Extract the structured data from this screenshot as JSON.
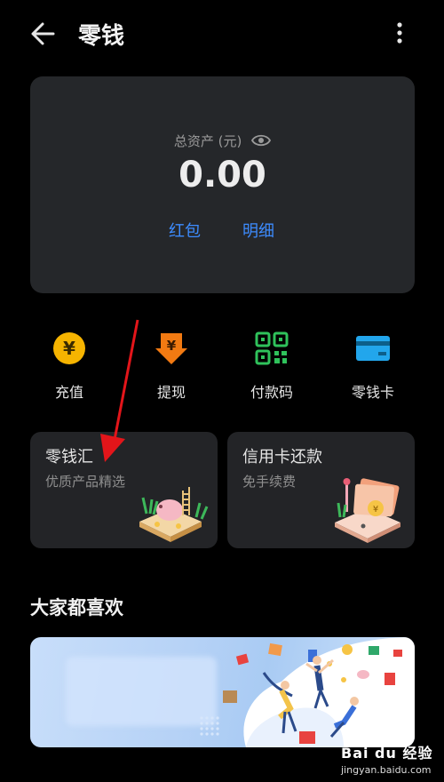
{
  "header": {
    "title": "零钱"
  },
  "assets": {
    "label": "总资产 (元)",
    "value": "0.00",
    "links": {
      "red_packet": "红包",
      "detail": "明细"
    }
  },
  "quick_actions": [
    {
      "label": "充值",
      "icon": "yuan-coin-icon",
      "color": "#f6b400"
    },
    {
      "label": "提现",
      "icon": "withdraw-icon",
      "color": "#f27a12"
    },
    {
      "label": "付款码",
      "icon": "qr-code-icon",
      "color": "#2fc25b"
    },
    {
      "label": "零钱卡",
      "icon": "card-icon",
      "color": "#22a6ec"
    }
  ],
  "promos": [
    {
      "title": "零钱汇",
      "subtitle": "优质产品精选"
    },
    {
      "title": "信用卡还款",
      "subtitle": "免手续费"
    }
  ],
  "section": {
    "title": "大家都喜欢"
  },
  "watermark": {
    "logo": "Bai du 经验",
    "url": "jingyan.baidu.com"
  },
  "colors": {
    "accent": "#3d8cff",
    "card_bg": "#25272a",
    "page_bg": "#000000"
  }
}
